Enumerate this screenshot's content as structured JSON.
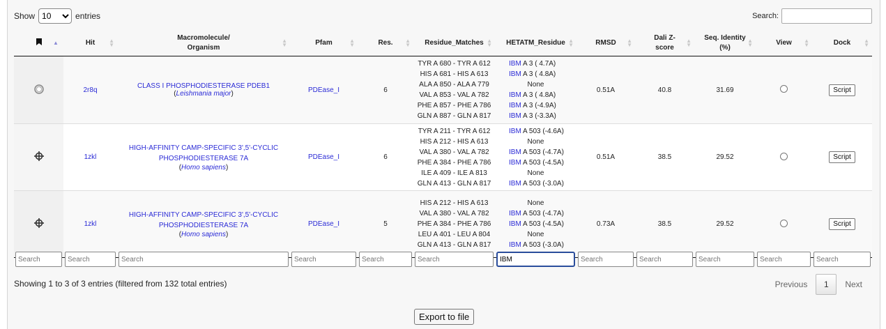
{
  "top": {
    "show_label": "Show",
    "entries_value": "10",
    "entries_label": "entries",
    "search_label": "Search:"
  },
  "columns": [
    {
      "label": ""
    },
    {
      "label": "Hit"
    },
    {
      "label": "Macromolecule/ Organism"
    },
    {
      "label": "Pfam"
    },
    {
      "label": "Res."
    },
    {
      "label": "Residue_Matches"
    },
    {
      "label": "HETATM_Residue"
    },
    {
      "label": "RMSD"
    },
    {
      "label": "Dali Z-score"
    },
    {
      "label": "Seq. Identity (%)"
    },
    {
      "label": "View"
    },
    {
      "label": "Dock"
    }
  ],
  "rows": [
    {
      "icon": "loading-icon",
      "hit": "2r8q",
      "name": "CLASS I PHOSPHODIESTERASE PDEB1",
      "organism": "Leishmania major",
      "pfam": "PDEase_I",
      "res": "6",
      "matches": [
        "TYR A 680 - TYR A 612",
        "HIS A 681 - HIS A 613",
        "ALA A 850 - ALA A 779",
        "VAL A 853 - VAL A 782",
        "PHE A 857 - PHE A 786",
        "GLN A 887 - GLN A 817"
      ],
      "hetatm": [
        {
          "tag": "IBM",
          "text": "A   3 ( 4.7A)"
        },
        {
          "tag": "IBM",
          "text": "A   3 ( 4.8A)"
        },
        {
          "tag": "",
          "text": "None"
        },
        {
          "tag": "IBM",
          "text": "A   3 ( 4.8A)"
        },
        {
          "tag": "IBM",
          "text": "A   3 (-4.9A)"
        },
        {
          "tag": "IBM",
          "text": "A   3 (-3.3A)"
        }
      ],
      "rmsd": "0.51A",
      "zscore": "40.8",
      "identity": "31.69",
      "dock": "Script"
    },
    {
      "icon": "crosshair-icon",
      "hit": "1zkl",
      "name": "HIGH-AFFINITY CAMP-SPECIFIC 3',5'-CYCLIC PHOSPHODIESTERASE 7A",
      "organism": "Homo sapiens",
      "pfam": "PDEase_I",
      "res": "6",
      "matches": [
        "TYR A 211 - TYR A 612",
        "HIS A 212 - HIS A 613",
        "VAL A 380 - VAL A 782",
        "PHE A 384 - PHE A 786",
        "ILE A 409 - ILE A 813",
        "GLN A 413 - GLN A 817"
      ],
      "hetatm": [
        {
          "tag": "IBM",
          "text": "A 503 (-4.6A)"
        },
        {
          "tag": "",
          "text": "None"
        },
        {
          "tag": "IBM",
          "text": "A 503 (-4.7A)"
        },
        {
          "tag": "IBM",
          "text": "A 503 (-4.5A)"
        },
        {
          "tag": "",
          "text": "None"
        },
        {
          "tag": "IBM",
          "text": "A 503 (-3.0A)"
        }
      ],
      "rmsd": "0.51A",
      "zscore": "38.5",
      "identity": "29.52",
      "dock": "Script"
    },
    {
      "icon": "crosshair-icon",
      "hit": "1zkl",
      "name": "HIGH-AFFINITY CAMP-SPECIFIC 3',5'-CYCLIC PHOSPHODIESTERASE 7A",
      "organism": "Homo sapiens",
      "pfam": "PDEase_I",
      "res": "5",
      "matches": [
        "HIS A 212 - HIS A 613",
        "VAL A 380 - VAL A 782",
        "PHE A 384 - PHE A 786",
        "LEU A 401 - LEU A 804",
        "GLN A 413 - GLN A 817"
      ],
      "hetatm": [
        {
          "tag": "",
          "text": "None"
        },
        {
          "tag": "IBM",
          "text": "A 503 (-4.7A)"
        },
        {
          "tag": "IBM",
          "text": "A 503 (-4.5A)"
        },
        {
          "tag": "",
          "text": "None"
        },
        {
          "tag": "IBM",
          "text": "A 503 (-3.0A)"
        }
      ],
      "rmsd": "0.73A",
      "zscore": "38.5",
      "identity": "29.52",
      "dock": "Script"
    }
  ],
  "filters": [
    {
      "placeholder": "Search",
      "value": ""
    },
    {
      "placeholder": "Search",
      "value": ""
    },
    {
      "placeholder": "Search",
      "value": ""
    },
    {
      "placeholder": "Search",
      "value": ""
    },
    {
      "placeholder": "Search",
      "value": ""
    },
    {
      "placeholder": "Search",
      "value": ""
    },
    {
      "placeholder": "Search",
      "value": "IBM"
    },
    {
      "placeholder": "Search",
      "value": ""
    },
    {
      "placeholder": "Search",
      "value": ""
    },
    {
      "placeholder": "Search",
      "value": ""
    },
    {
      "placeholder": "Search",
      "value": ""
    },
    {
      "placeholder": "Search",
      "value": ""
    }
  ],
  "footer": {
    "info": "Showing 1 to 3 of 3 entries (filtered from 132 total entries)",
    "previous": "Previous",
    "page": "1",
    "next": "Next",
    "export": "Export to file"
  },
  "colors": {
    "link": "#2b2bd6",
    "focus_border": "#2a4d9c"
  }
}
